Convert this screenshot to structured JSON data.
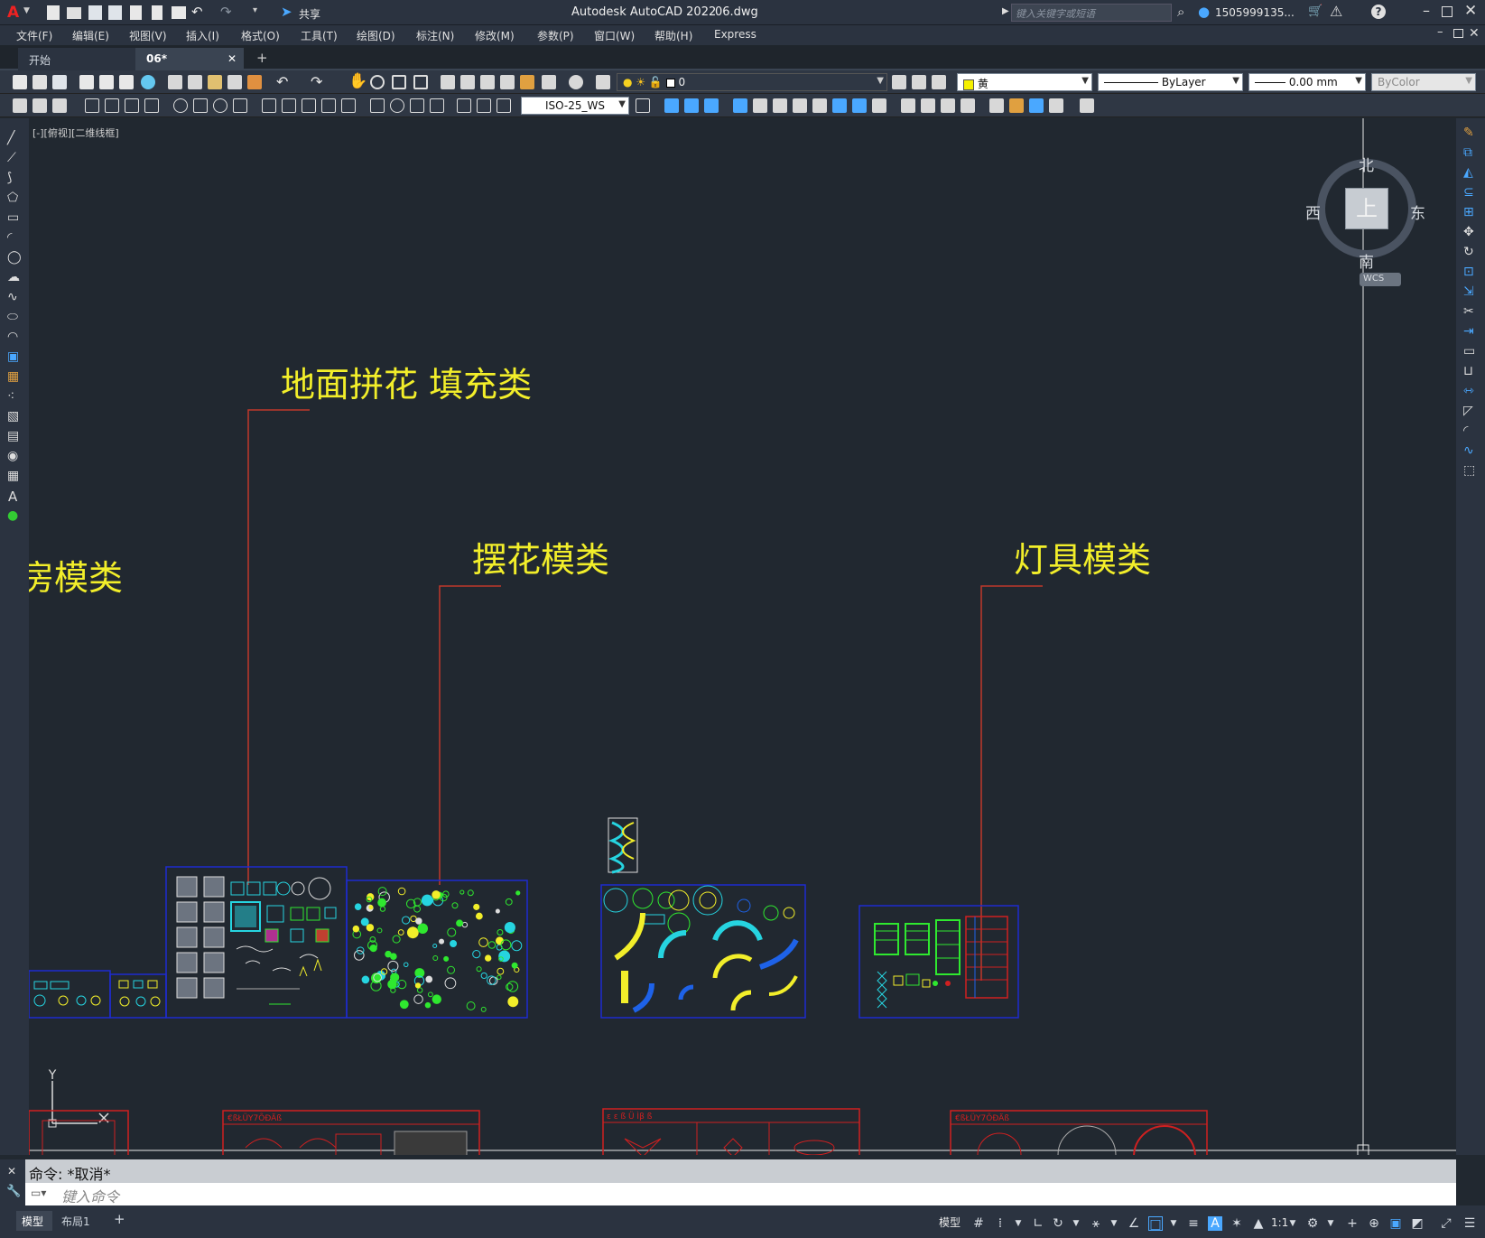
{
  "titlebar": {
    "app_title": "Autodesk AutoCAD 2022",
    "file_name": "06.dwg",
    "share_label": "共享",
    "search_placeholder": "键入关键字或短语",
    "user_name": "1505999135..."
  },
  "menu": [
    "文件(F)",
    "编辑(E)",
    "视图(V)",
    "插入(I)",
    "格式(O)",
    "工具(T)",
    "绘图(D)",
    "标注(N)",
    "修改(M)",
    "参数(P)",
    "窗口(W)",
    "帮助(H)",
    "Express"
  ],
  "tabs": [
    {
      "label": "开始"
    },
    {
      "label": "06*",
      "close": "✕"
    }
  ],
  "new_tab": "+",
  "layer_combo": "0",
  "color_combo": "黄",
  "linetype_combo": "ByLayer",
  "lineweight_combo": "0.00 mm",
  "plotstyle_combo": "ByColor",
  "dimstyle_combo": "ISO-25_WS",
  "viewport_label": "[-][俯视][二维线框]",
  "viewcube": {
    "north": "北",
    "south": "南",
    "east": "东",
    "west": "西",
    "top": "上",
    "wcs": "WCS"
  },
  "drawing_labels": {
    "label_partial": "房模类",
    "label_floor": "地面拼花  填充类",
    "label_flower": "摆花模类",
    "label_lamp": "灯具模类"
  },
  "bottom_strip_texts": [
    "€ßŁÜY7ÕÐÄß",
    "ε ε ß Ü Ìβ ß",
    "€ßŁÜY7ÕÐÄß"
  ],
  "ucs_y_label": "Y",
  "command": {
    "history": "命令:  *取消*",
    "placeholder": "键入命令"
  },
  "statusbar": {
    "tab_model": "模型",
    "tab_layout": "布局1",
    "add": "+",
    "model_button": "模型",
    "scale": "1:1"
  },
  "colors": {
    "label_yellow": "#f2ee2a",
    "leader_red": "#c0392b",
    "frame_blue": "#1e2bd0",
    "block_green": "#2fe82f",
    "block_cyan": "#26d4e0"
  }
}
